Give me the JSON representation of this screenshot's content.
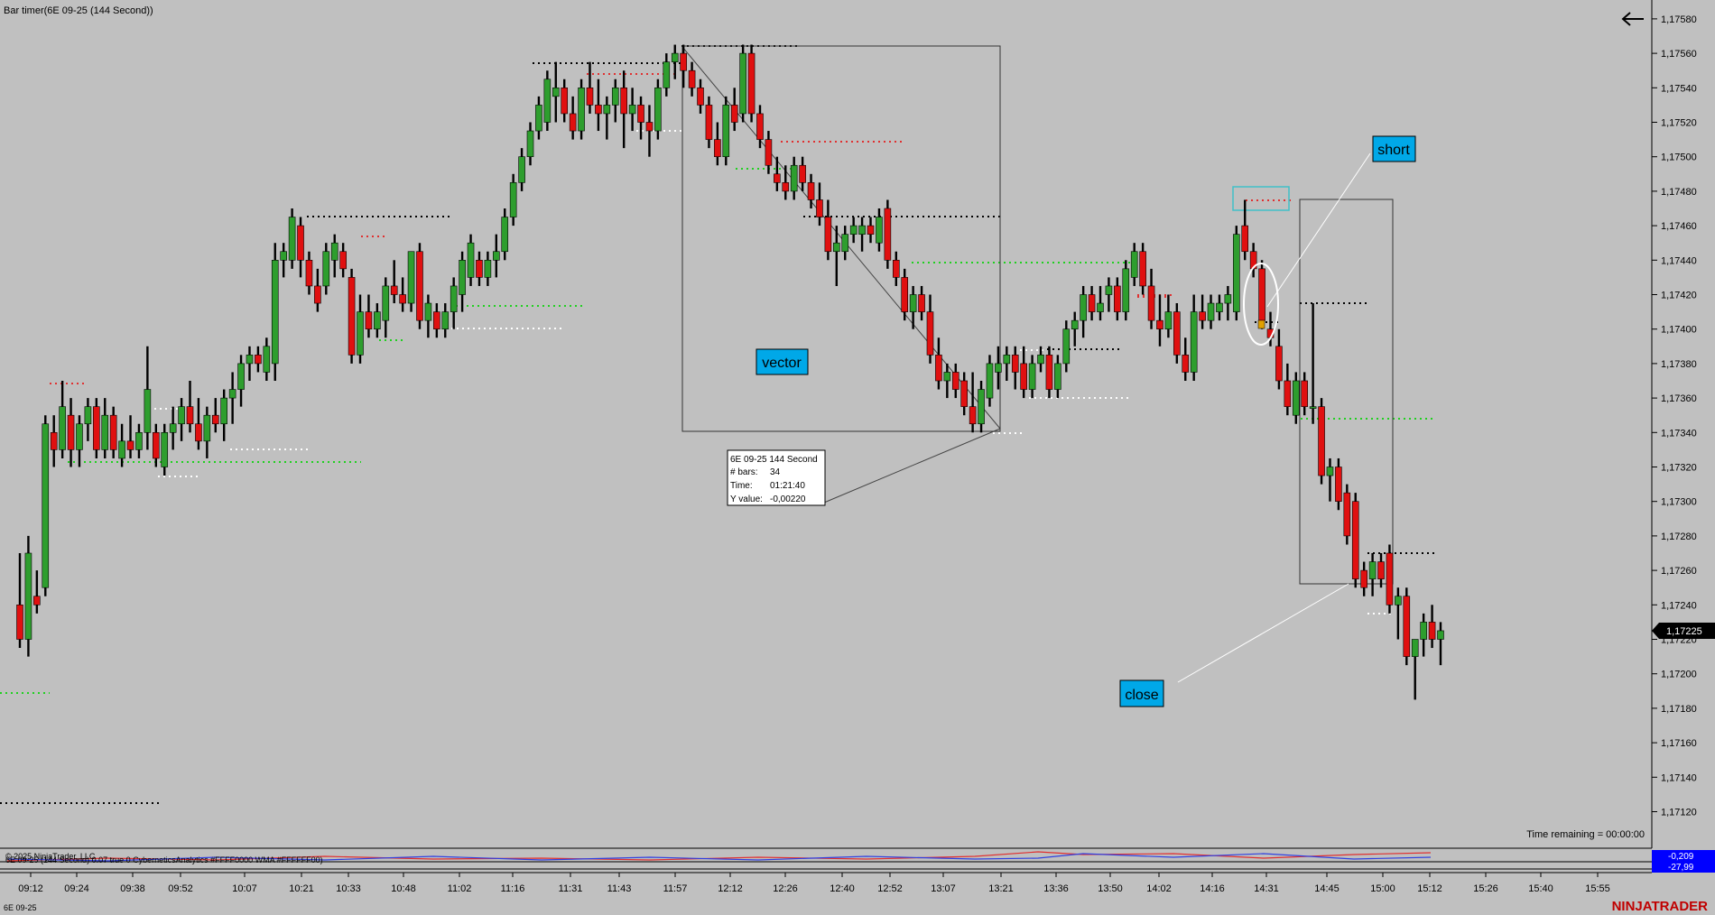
{
  "window": {
    "title": "Bar timer(6E 09-25 (144 Second))",
    "instrument_label": "6E 09-25",
    "brand": "NINJATRADER",
    "back_icon": "arrow-left-icon",
    "time_remaining": "Time remaining = 00:00:00",
    "copyright": "© 2025 NinjaTrader, LLC",
    "indicator_label": "6E 09-25 (144 Second) 0.07 true 0 CyberneticsAnalytics #FFFF0000 WMA #FFFFFF00)"
  },
  "colors": {
    "background": "#c0c0c0",
    "bull": "#2e9e2e",
    "bear": "#e01010",
    "wick": "#000000",
    "callout": "#00a8e8",
    "price_marker": "#000000",
    "indicator_marker": "#0000ff",
    "brand": "#c00000"
  },
  "price_axis": {
    "labels": [
      "1,17580",
      "1,17560",
      "1,17540",
      "1,17520",
      "1,17500",
      "1,17480",
      "1,17460",
      "1,17440",
      "1,17420",
      "1,17400",
      "1,17380",
      "1,17360",
      "1,17340",
      "1,17320",
      "1,17300",
      "1,17280",
      "1,17260",
      "1,17240",
      "1,17220",
      "1,17200",
      "1,17180",
      "1,17160",
      "1,17140",
      "1,17120"
    ],
    "current_price": "1,17225"
  },
  "time_axis": {
    "labels": [
      "09:12",
      "09:24",
      "09:38",
      "09:52",
      "10:07",
      "10:21",
      "10:33",
      "10:48",
      "11:02",
      "11:16",
      "11:31",
      "11:43",
      "11:57",
      "12:12",
      "12:26",
      "12:40",
      "12:52",
      "13:07",
      "13:21",
      "13:36",
      "13:50",
      "14:02",
      "14:16",
      "14:31",
      "14:45",
      "15:00",
      "15:12",
      "15:26",
      "15:40",
      "15:55"
    ]
  },
  "annotations": {
    "vector": "vector",
    "short": "short",
    "close": "close"
  },
  "measure_box": {
    "line1": "6E 09-25 144 Second",
    "bars_label": "# bars:",
    "bars_value": "34",
    "time_label": "Time:",
    "time_value": "01:21:40",
    "y_label": "Y value:",
    "y_value": "-0,00220"
  },
  "indicator_values": [
    "-0,209",
    "-27,99"
  ],
  "chart_data": {
    "type": "candlestick",
    "symbol": "6E 09-25",
    "interval": "144 Second",
    "ylim": [
      1.1711,
      1.1759
    ],
    "candles_ohlc": [
      [
        1.1724,
        1.1727,
        1.17215,
        1.1722
      ],
      [
        1.1722,
        1.1728,
        1.1721,
        1.1727
      ],
      [
        1.17245,
        1.1726,
        1.17235,
        1.1724
      ],
      [
        1.1725,
        1.1735,
        1.17245,
        1.17345
      ],
      [
        1.1734,
        1.1735,
        1.1732,
        1.1733
      ],
      [
        1.1733,
        1.1737,
        1.17325,
        1.17355
      ],
      [
        1.1735,
        1.1736,
        1.1732,
        1.1733
      ],
      [
        1.1733,
        1.1735,
        1.1732,
        1.17345
      ],
      [
        1.17345,
        1.1736,
        1.17335,
        1.17355
      ],
      [
        1.17355,
        1.1736,
        1.17325,
        1.1733
      ],
      [
        1.1733,
        1.1736,
        1.17325,
        1.1735
      ],
      [
        1.1735,
        1.17355,
        1.17325,
        1.1733
      ],
      [
        1.17325,
        1.17345,
        1.1732,
        1.17335
      ],
      [
        1.17335,
        1.1735,
        1.17325,
        1.1733
      ],
      [
        1.1733,
        1.17345,
        1.17325,
        1.1734
      ],
      [
        1.1734,
        1.1739,
        1.1733,
        1.17365
      ],
      [
        1.1734,
        1.17345,
        1.1732,
        1.17325
      ],
      [
        1.1732,
        1.17345,
        1.17315,
        1.1734
      ],
      [
        1.1734,
        1.17355,
        1.1733,
        1.17345
      ],
      [
        1.17345,
        1.1736,
        1.17335,
        1.17355
      ],
      [
        1.17355,
        1.1737,
        1.1734,
        1.17345
      ],
      [
        1.17345,
        1.1736,
        1.1733,
        1.17335
      ],
      [
        1.17335,
        1.17355,
        1.17325,
        1.1735
      ],
      [
        1.1735,
        1.1736,
        1.1734,
        1.17345
      ],
      [
        1.17345,
        1.17365,
        1.17335,
        1.1736
      ],
      [
        1.1736,
        1.17375,
        1.17345,
        1.17365
      ],
      [
        1.17365,
        1.17385,
        1.17355,
        1.1738
      ],
      [
        1.1738,
        1.1739,
        1.1737,
        1.17385
      ],
      [
        1.17385,
        1.1739,
        1.17375,
        1.1738
      ],
      [
        1.17375,
        1.17395,
        1.1737,
        1.1739
      ],
      [
        1.1738,
        1.1745,
        1.1737,
        1.1744
      ],
      [
        1.1744,
        1.1745,
        1.1743,
        1.17445
      ],
      [
        1.1744,
        1.1747,
        1.17435,
        1.17465
      ],
      [
        1.1746,
        1.17465,
        1.1743,
        1.1744
      ],
      [
        1.1744,
        1.17445,
        1.1742,
        1.17425
      ],
      [
        1.17425,
        1.17435,
        1.1741,
        1.17415
      ],
      [
        1.17425,
        1.1745,
        1.1742,
        1.17445
      ],
      [
        1.1744,
        1.17455,
        1.1743,
        1.1745
      ],
      [
        1.17445,
        1.1745,
        1.1743,
        1.17435
      ],
      [
        1.1743,
        1.17435,
        1.1738,
        1.17385
      ],
      [
        1.17385,
        1.1742,
        1.1738,
        1.1741
      ],
      [
        1.1741,
        1.1742,
        1.17395,
        1.174
      ],
      [
        1.174,
        1.17415,
        1.17395,
        1.1741
      ],
      [
        1.17405,
        1.1743,
        1.17395,
        1.17425
      ],
      [
        1.17425,
        1.1744,
        1.17415,
        1.1742
      ],
      [
        1.1742,
        1.1743,
        1.1741,
        1.17415
      ],
      [
        1.17415,
        1.17445,
        1.1741,
        1.17445
      ],
      [
        1.17445,
        1.1745,
        1.174,
        1.17405
      ],
      [
        1.17405,
        1.1742,
        1.17395,
        1.17415
      ],
      [
        1.1741,
        1.17415,
        1.17395,
        1.174
      ],
      [
        1.174,
        1.17415,
        1.17395,
        1.1741
      ],
      [
        1.1741,
        1.1743,
        1.174,
        1.17425
      ],
      [
        1.1742,
        1.17445,
        1.1741,
        1.1744
      ],
      [
        1.1743,
        1.17455,
        1.17425,
        1.1745
      ],
      [
        1.1744,
        1.17445,
        1.17425,
        1.1743
      ],
      [
        1.1743,
        1.17445,
        1.17425,
        1.1744
      ],
      [
        1.1744,
        1.17455,
        1.1743,
        1.17445
      ],
      [
        1.17445,
        1.1747,
        1.1744,
        1.17465
      ],
      [
        1.17465,
        1.1749,
        1.1746,
        1.17485
      ],
      [
        1.17485,
        1.17505,
        1.1748,
        1.175
      ],
      [
        1.175,
        1.1752,
        1.17495,
        1.17515
      ],
      [
        1.17515,
        1.17535,
        1.1751,
        1.1753
      ],
      [
        1.1752,
        1.1755,
        1.17515,
        1.17545
      ],
      [
        1.17535,
        1.17555,
        1.1752,
        1.1754
      ],
      [
        1.1754,
        1.17545,
        1.1752,
        1.17525
      ],
      [
        1.17525,
        1.17535,
        1.1751,
        1.17515
      ],
      [
        1.17515,
        1.17545,
        1.1751,
        1.1754
      ],
      [
        1.1754,
        1.17555,
        1.17525,
        1.1753
      ],
      [
        1.1753,
        1.17545,
        1.17515,
        1.17525
      ],
      [
        1.17525,
        1.17535,
        1.1751,
        1.1753
      ],
      [
        1.1753,
        1.17545,
        1.1752,
        1.1754
      ],
      [
        1.1754,
        1.1755,
        1.17505,
        1.17525
      ],
      [
        1.17525,
        1.1754,
        1.17515,
        1.1753
      ],
      [
        1.1753,
        1.17535,
        1.1751,
        1.1752
      ],
      [
        1.1752,
        1.1753,
        1.175,
        1.17515
      ],
      [
        1.17515,
        1.17545,
        1.1751,
        1.1754
      ],
      [
        1.1754,
        1.1756,
        1.17535,
        1.17555
      ],
      [
        1.17555,
        1.17565,
        1.17545,
        1.1756
      ],
      [
        1.1756,
        1.17565,
        1.1754,
        1.1755
      ],
      [
        1.1755,
        1.17555,
        1.17535,
        1.1754
      ],
      [
        1.1754,
        1.17545,
        1.17525,
        1.1753
      ],
      [
        1.1753,
        1.17535,
        1.17505,
        1.1751
      ],
      [
        1.1751,
        1.1752,
        1.17495,
        1.175
      ],
      [
        1.175,
        1.17535,
        1.17495,
        1.1753
      ],
      [
        1.1753,
        1.1754,
        1.17515,
        1.1752
      ],
      [
        1.17525,
        1.17565,
        1.1752,
        1.1756
      ],
      [
        1.1756,
        1.17565,
        1.1752,
        1.17525
      ],
      [
        1.17525,
        1.1753,
        1.17505,
        1.1751
      ],
      [
        1.1751,
        1.17515,
        1.1749,
        1.17495
      ],
      [
        1.1749,
        1.175,
        1.1748,
        1.17485
      ],
      [
        1.17485,
        1.17495,
        1.17475,
        1.1748
      ],
      [
        1.1748,
        1.175,
        1.17475,
        1.17495
      ],
      [
        1.17495,
        1.175,
        1.1748,
        1.17485
      ],
      [
        1.17485,
        1.1749,
        1.1747,
        1.17475
      ],
      [
        1.17475,
        1.17485,
        1.1746,
        1.17465
      ],
      [
        1.17465,
        1.17475,
        1.1744,
        1.17445
      ],
      [
        1.17445,
        1.1746,
        1.17425,
        1.1745
      ],
      [
        1.17445,
        1.1746,
        1.1744,
        1.17455
      ],
      [
        1.17455,
        1.17465,
        1.1745,
        1.1746
      ],
      [
        1.17455,
        1.17465,
        1.17445,
        1.1746
      ],
      [
        1.1746,
        1.17465,
        1.1745,
        1.17455
      ],
      [
        1.1745,
        1.1747,
        1.17445,
        1.17465
      ],
      [
        1.1747,
        1.17475,
        1.17435,
        1.1744
      ],
      [
        1.1744,
        1.17445,
        1.17425,
        1.1743
      ],
      [
        1.1743,
        1.17435,
        1.17405,
        1.1741
      ],
      [
        1.1741,
        1.17425,
        1.174,
        1.1742
      ],
      [
        1.1742,
        1.17425,
        1.17405,
        1.1741
      ],
      [
        1.1741,
        1.1742,
        1.1738,
        1.17385
      ],
      [
        1.17385,
        1.17395,
        1.17365,
        1.1737
      ],
      [
        1.1737,
        1.1738,
        1.1736,
        1.17375
      ],
      [
        1.17375,
        1.1738,
        1.1736,
        1.17365
      ],
      [
        1.1737,
        1.17375,
        1.1735,
        1.17355
      ],
      [
        1.17355,
        1.17375,
        1.1734,
        1.17345
      ],
      [
        1.17345,
        1.1737,
        1.1734,
        1.17365
      ],
      [
        1.1736,
        1.17385,
        1.17355,
        1.1738
      ],
      [
        1.17375,
        1.1739,
        1.17365,
        1.1738
      ],
      [
        1.1738,
        1.1739,
        1.1737,
        1.17385
      ],
      [
        1.17385,
        1.1739,
        1.17365,
        1.17375
      ],
      [
        1.1738,
        1.1739,
        1.1736,
        1.17365
      ],
      [
        1.17365,
        1.17385,
        1.1736,
        1.1738
      ],
      [
        1.1738,
        1.1739,
        1.17375,
        1.17385
      ],
      [
        1.17385,
        1.1739,
        1.1736,
        1.17365
      ],
      [
        1.17365,
        1.17385,
        1.1736,
        1.1738
      ],
      [
        1.1738,
        1.17405,
        1.17375,
        1.174
      ],
      [
        1.174,
        1.1741,
        1.1739,
        1.17405
      ],
      [
        1.17405,
        1.17425,
        1.17395,
        1.1742
      ],
      [
        1.1742,
        1.17425,
        1.17405,
        1.1741
      ],
      [
        1.1741,
        1.17425,
        1.17405,
        1.17415
      ],
      [
        1.1742,
        1.1743,
        1.1741,
        1.17425
      ],
      [
        1.17425,
        1.1743,
        1.17405,
        1.1741
      ],
      [
        1.1741,
        1.1744,
        1.17405,
        1.17435
      ],
      [
        1.1743,
        1.1745,
        1.17425,
        1.17445
      ],
      [
        1.17445,
        1.1745,
        1.1742,
        1.17425
      ],
      [
        1.17425,
        1.17435,
        1.174,
        1.17405
      ],
      [
        1.17405,
        1.1742,
        1.1739,
        1.174
      ],
      [
        1.174,
        1.1742,
        1.17395,
        1.1741
      ],
      [
        1.1741,
        1.17415,
        1.1738,
        1.17385
      ],
      [
        1.17385,
        1.17395,
        1.1737,
        1.17375
      ],
      [
        1.17375,
        1.1742,
        1.1737,
        1.1741
      ],
      [
        1.1741,
        1.1742,
        1.174,
        1.17405
      ],
      [
        1.17405,
        1.1742,
        1.174,
        1.17415
      ],
      [
        1.1741,
        1.1742,
        1.17405,
        1.17415
      ],
      [
        1.17415,
        1.17425,
        1.17405,
        1.1742
      ],
      [
        1.1741,
        1.1746,
        1.17405,
        1.17455
      ],
      [
        1.1746,
        1.17475,
        1.1744,
        1.17445
      ],
      [
        1.17445,
        1.1745,
        1.1743,
        1.17435
      ],
      [
        1.17435,
        1.1744,
        1.174,
        1.17405
      ],
      [
        1.174,
        1.1741,
        1.1739,
        1.17395
      ],
      [
        1.1739,
        1.174,
        1.17365,
        1.1737
      ],
      [
        1.1737,
        1.1738,
        1.1735,
        1.17355
      ],
      [
        1.1735,
        1.17375,
        1.17345,
        1.1737
      ],
      [
        1.1737,
        1.17375,
        1.1735,
        1.17355
      ],
      [
        1.17355,
        1.17415,
        1.17345,
        1.17355
      ],
      [
        1.17355,
        1.1736,
        1.1731,
        1.17315
      ],
      [
        1.17315,
        1.17325,
        1.173,
        1.1732
      ],
      [
        1.1732,
        1.17325,
        1.17295,
        1.173
      ],
      [
        1.17305,
        1.1731,
        1.17275,
        1.1728
      ],
      [
        1.173,
        1.17305,
        1.1725,
        1.17255
      ],
      [
        1.1726,
        1.17265,
        1.17245,
        1.1725
      ],
      [
        1.17255,
        1.1727,
        1.17245,
        1.17265
      ],
      [
        1.17265,
        1.1727,
        1.1725,
        1.17255
      ],
      [
        1.1727,
        1.17275,
        1.17235,
        1.1724
      ],
      [
        1.1724,
        1.1725,
        1.1722,
        1.17245
      ],
      [
        1.17245,
        1.1725,
        1.17205,
        1.1721
      ],
      [
        1.1721,
        1.1722,
        1.17185,
        1.1722
      ],
      [
        1.1722,
        1.17235,
        1.1721,
        1.1723
      ],
      [
        1.1723,
        1.1724,
        1.17215,
        1.1722
      ],
      [
        1.1722,
        1.1723,
        1.17205,
        1.17225
      ]
    ]
  }
}
